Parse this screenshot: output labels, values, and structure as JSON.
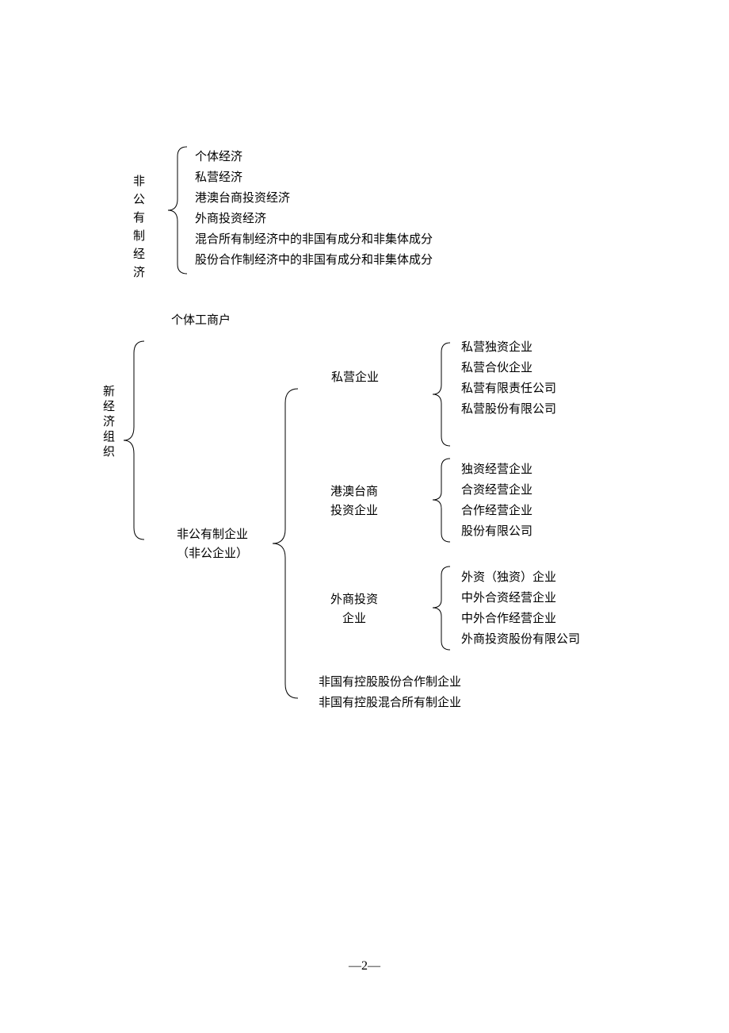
{
  "section1": {
    "label": "非公有制经济",
    "items": [
      "个体经济",
      "私营经济",
      "港澳台商投资经济",
      "外商投资经济",
      "混合所有制经济中的非国有成分和非集体成分",
      "股份合作制经济中的非国有成分和非集体成分"
    ]
  },
  "section2": {
    "label": "新经济组织",
    "top_item": "个体工商户",
    "mid_label_line1": "非公有制企业",
    "mid_label_line2": "（非公企业）",
    "branches": [
      {
        "label": "私营企业",
        "items": [
          "私营独资企业",
          "私营合伙企业",
          "私营有限责任公司",
          "私营股份有限公司"
        ]
      },
      {
        "label_line1": "港澳台商",
        "label_line2": "投资企业",
        "items": [
          "独资经营企业",
          "合资经营企业",
          "合作经营企业",
          "股份有限公司"
        ]
      },
      {
        "label_line1": "外商投资",
        "label_line2": "企业",
        "items": [
          "外资（独资）企业",
          "中外合资经营企业",
          "中外合作经营企业",
          "外商投资股份有限公司"
        ]
      }
    ],
    "bottom_items": [
      "非国有控股股份合作制企业",
      "非国有控股混合所有制企业"
    ]
  },
  "page": "2"
}
